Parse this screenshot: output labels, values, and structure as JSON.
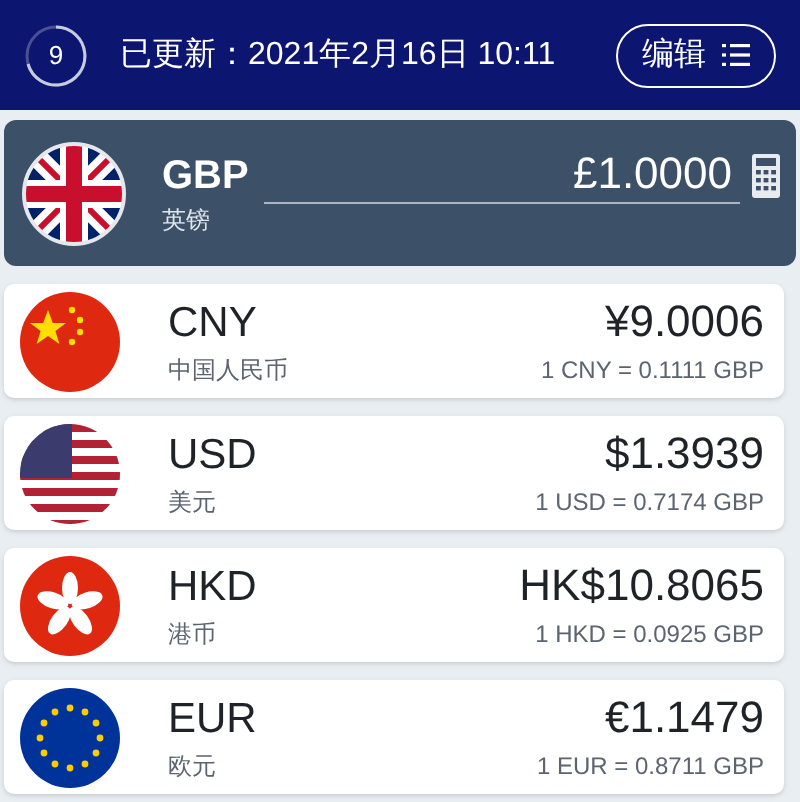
{
  "header": {
    "countdown": "9",
    "updated": "已更新：2021年2月16日 10:11",
    "edit_button": "编辑"
  },
  "base": {
    "code": "GBP",
    "name": "英镑",
    "amount": "£1.0000"
  },
  "currencies": [
    {
      "code": "CNY",
      "name": "中国人民币",
      "amount": "¥9.0006",
      "rate": "1 CNY = 0.1111 GBP"
    },
    {
      "code": "USD",
      "name": "美元",
      "amount": "$1.3939",
      "rate": "1 USD = 0.7174 GBP"
    },
    {
      "code": "HKD",
      "name": "港币",
      "amount": "HK$10.8065",
      "rate": "1 HKD = 0.0925 GBP"
    },
    {
      "code": "EUR",
      "name": "欧元",
      "amount": "€1.1479",
      "rate": "1 EUR = 0.8711 GBP"
    }
  ]
}
